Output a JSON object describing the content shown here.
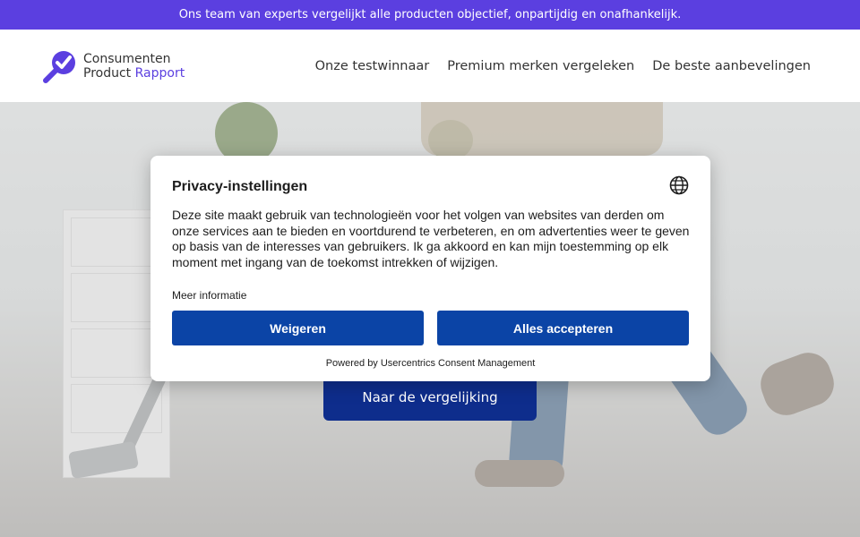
{
  "topbar": {
    "text": "Ons team van experts vergelijkt alle producten objectief, onpartijdig en onafhankelijk."
  },
  "logo": {
    "line1": "Consumenten",
    "line2_a": "Product ",
    "line2_b": "Rapport",
    "icon": "magnifier-check-icon"
  },
  "nav": {
    "items": [
      {
        "label": "Onze testwinnaar"
      },
      {
        "label": "Premium merken vergeleken"
      },
      {
        "label": "De beste aanbevelingen"
      }
    ]
  },
  "hero": {
    "cta_label": "Naar de vergelijking"
  },
  "consent": {
    "title": "Privacy-instellingen",
    "body": "Deze site maakt gebruik van technologieën voor het volgen van websites van derden om onze services aan te bieden en voortdurend te verbeteren, en om advertenties weer te geven op basis van de interesses van gebruikers. Ik ga akkoord en kan mijn toestemming op elk moment met ingang van de toekomst intrekken of wijzigen.",
    "more_label": "Meer informatie",
    "deny_label": "Weigeren",
    "accept_label": "Alles accepteren",
    "powered_by": "Powered by Usercentrics Consent Management",
    "language_icon": "globe-icon"
  },
  "colors": {
    "brand": "#5b3fe0",
    "cta": "#0e2d8c",
    "consent_button": "#0b44a6"
  }
}
